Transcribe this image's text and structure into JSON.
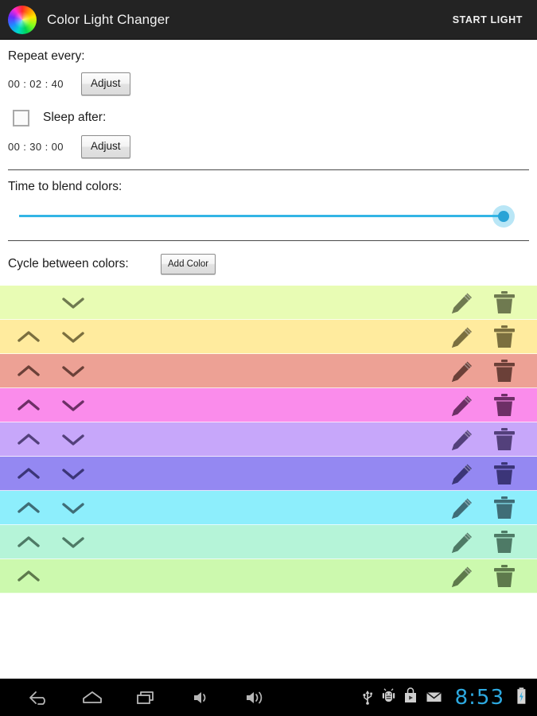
{
  "appbar": {
    "icon": "color-wheel-icon",
    "title": "Color Light Changer",
    "action_label": "START LIGHT"
  },
  "settings": {
    "repeat": {
      "label": "Repeat every:",
      "value": "00 : 02 : 40",
      "adjust_label": "Adjust"
    },
    "sleep": {
      "label": "Sleep after:",
      "checked": false,
      "value": "00 : 30 : 00",
      "adjust_label": "Adjust"
    },
    "blend": {
      "label": "Time to blend colors:",
      "slider_percent": 100
    },
    "cycle": {
      "label": "Cycle between colors:",
      "add_color_label": "Add Color"
    }
  },
  "color_list": {
    "rows": [
      {
        "color": "#e8fcb4",
        "icon_color": "#6f7a50",
        "move_up": false,
        "move_down": true
      },
      {
        "color": "#ffeb9e",
        "icon_color": "#7b6f3f",
        "move_up": true,
        "move_down": true
      },
      {
        "color": "#eda195",
        "icon_color": "#6b4038",
        "move_up": true,
        "move_down": true
      },
      {
        "color": "#fa8ceb",
        "icon_color": "#6d2f66",
        "move_up": true,
        "move_down": true
      },
      {
        "color": "#c7a7fa",
        "icon_color": "#53407b",
        "move_up": true,
        "move_down": true
      },
      {
        "color": "#9488f2",
        "icon_color": "#3b3578",
        "move_up": true,
        "move_down": true
      },
      {
        "color": "#8deefc",
        "icon_color": "#3f6d77",
        "move_up": true,
        "move_down": true
      },
      {
        "color": "#b5f4d8",
        "icon_color": "#4e7a66",
        "move_up": true,
        "move_down": true
      },
      {
        "color": "#ccf9ae",
        "icon_color": "#5e7a4c",
        "move_up": true,
        "move_down": false
      }
    ],
    "edit_icon": "pencil-icon",
    "delete_icon": "trash-icon",
    "move_up_icon": "chevron-up-icon",
    "move_down_icon": "chevron-down-icon"
  },
  "navbar": {
    "buttons": [
      {
        "name": "back-icon"
      },
      {
        "name": "home-icon"
      },
      {
        "name": "recents-icon"
      },
      {
        "name": "volume-down-icon"
      },
      {
        "name": "volume-up-icon"
      }
    ],
    "tray": [
      {
        "name": "usb-icon"
      },
      {
        "name": "android-debug-icon"
      },
      {
        "name": "play-store-icon"
      },
      {
        "name": "mail-icon"
      }
    ],
    "clock": "8:53",
    "battery_icon": "battery-charging-icon",
    "clock_color": "#2da9e0"
  }
}
